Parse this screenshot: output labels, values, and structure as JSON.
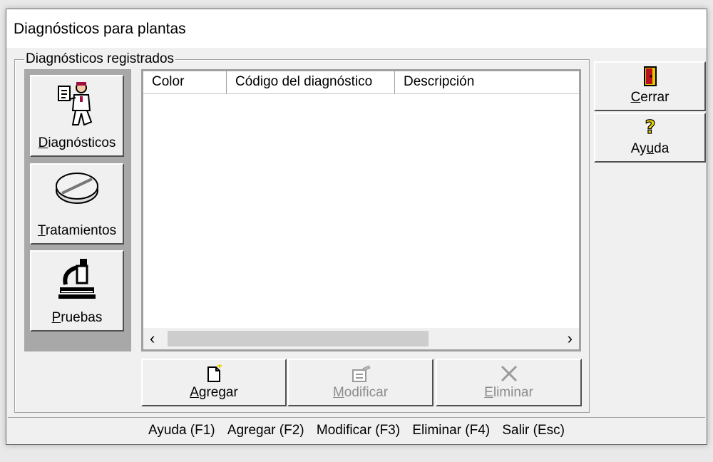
{
  "window": {
    "title": "Diagnósticos para plantas"
  },
  "group": {
    "label": "Diagnósticos registrados"
  },
  "side_buttons": [
    {
      "label": "Diagnósticos",
      "icon": "doctor-icon"
    },
    {
      "label": "Tratamientos",
      "icon": "pill-icon"
    },
    {
      "label": "Pruebas",
      "icon": "microscope-icon"
    }
  ],
  "table": {
    "columns": [
      "Color",
      "Código del diagnóstico",
      "Descripción"
    ],
    "rows": []
  },
  "actions": {
    "agregar": "Agregar",
    "modificar": "Modificar",
    "eliminar": "Eliminar"
  },
  "right_buttons": {
    "cerrar": "Cerrar",
    "ayuda": "Ayuda"
  },
  "statusbar": [
    "Ayuda (F1)",
    "Agregar (F2)",
    "Modificar (F3)",
    "Eliminar (F4)",
    "Salir (Esc)"
  ]
}
